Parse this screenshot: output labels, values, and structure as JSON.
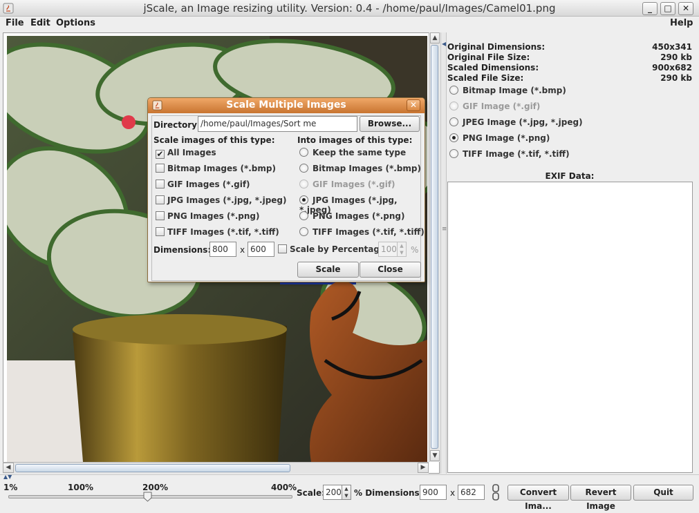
{
  "window": {
    "title": "jScale, an Image resizing utility.  Version: 0.4 - /home/paul/Images/Camel01.png",
    "minimize": "_",
    "maximize": "□",
    "close": "✕"
  },
  "menu": {
    "file": "File",
    "edit": "Edit",
    "options": "Options",
    "help": "Help"
  },
  "info": {
    "original_dimensions_label": "Original Dimensions:",
    "original_dimensions_value": "450x341",
    "original_file_size_label": "Original File Size:",
    "original_file_size_value": "290 kb",
    "scaled_dimensions_label": "Scaled Dimensions:",
    "scaled_dimensions_value": "900x682",
    "scaled_file_size_label": "Scaled File Size:",
    "scaled_file_size_value": "290 kb"
  },
  "format_options": [
    {
      "label": "Bitmap Image (*.bmp)",
      "selected": false,
      "enabled": true
    },
    {
      "label": "GIF Image (*.gif)",
      "selected": false,
      "enabled": false
    },
    {
      "label": "JPEG Image (*.jpg, *.jpeg)",
      "selected": false,
      "enabled": true
    },
    {
      "label": "PNG Image (*.png)",
      "selected": true,
      "enabled": true
    },
    {
      "label": "TIFF Image (*.tif, *.tiff)",
      "selected": false,
      "enabled": true
    }
  ],
  "exif_label": "EXIF Data:",
  "bottom": {
    "ticks": [
      "1%",
      "100%",
      "200%",
      "400%"
    ],
    "slider_value_percent": 200,
    "scale_label": "Scale:",
    "scale_value": "200",
    "percent_dimensions_label": "% Dimensions:",
    "width_value": "900",
    "x_label": "x",
    "height_value": "682",
    "convert_button": "Convert Ima...",
    "revert_button": "Revert Image",
    "quit_button": "Quit"
  },
  "dialog": {
    "title": "Scale Multiple Images",
    "close": "✕",
    "directory_label": "Directory:",
    "directory_value": "/home/paul/Images/Sort me",
    "browse_button": "Browse...",
    "source_header": "Scale images of this type:",
    "target_header": "Into images of this type:",
    "source_types": [
      {
        "label": "All Images",
        "checked": true
      },
      {
        "label": "Bitmap Images (*.bmp)",
        "checked": false
      },
      {
        "label": "GIF Images (*.gif)",
        "checked": false
      },
      {
        "label": "JPG Images (*.jpg, *.jpeg)",
        "checked": false
      },
      {
        "label": "PNG Images (*.png)",
        "checked": false
      },
      {
        "label": "TIFF Images (*.tif, *.tiff)",
        "checked": false
      }
    ],
    "target_types": [
      {
        "label": "Keep the same type",
        "selected": false,
        "enabled": true
      },
      {
        "label": "Bitmap Images (*.bmp)",
        "selected": false,
        "enabled": true
      },
      {
        "label": "GIF Images (*.gif)",
        "selected": false,
        "enabled": false
      },
      {
        "label": "JPG Images (*.jpg, *.jpeg)",
        "selected": true,
        "enabled": true
      },
      {
        "label": "PNG Images (*.png)",
        "selected": false,
        "enabled": true
      },
      {
        "label": "TIFF Images (*.tif, *.tiff)",
        "selected": false,
        "enabled": true
      }
    ],
    "dimensions_label": "Dimensions:",
    "dim_width": "800",
    "dim_x": "x",
    "dim_height": "600",
    "scale_by_percentage_label": "Scale by Percentage:",
    "percentage_value": "100",
    "percent_sign": "%",
    "scale_button": "Scale",
    "close_button": "Close"
  }
}
